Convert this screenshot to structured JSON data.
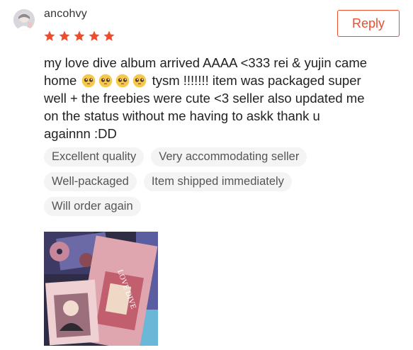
{
  "review": {
    "username": "ancohvy",
    "avatar_icon": "user-avatar",
    "rating": 5,
    "star_icon": "star-icon",
    "star_color": "#ee4d2d",
    "reply_label": "Reply",
    "accent_color": "#ee4d2d",
    "text_parts": [
      "my love dive album arrived AAAA <333 rei & yujin came",
      "home",
      "tysm !!!!!!! item was packaged super",
      "well + the freebies were cute <3 seller also updated me",
      "on the status without me having to askk thank u",
      "againnn :DD"
    ],
    "emoji_icon": "pleading-face-emoji",
    "emoji_count": 4,
    "tags": [
      "Excellent quality",
      "Very accommodating seller",
      "Well-packaged",
      "Item shipped immediately",
      "Will order again"
    ],
    "photo_caption": "LOVE DIVE"
  }
}
